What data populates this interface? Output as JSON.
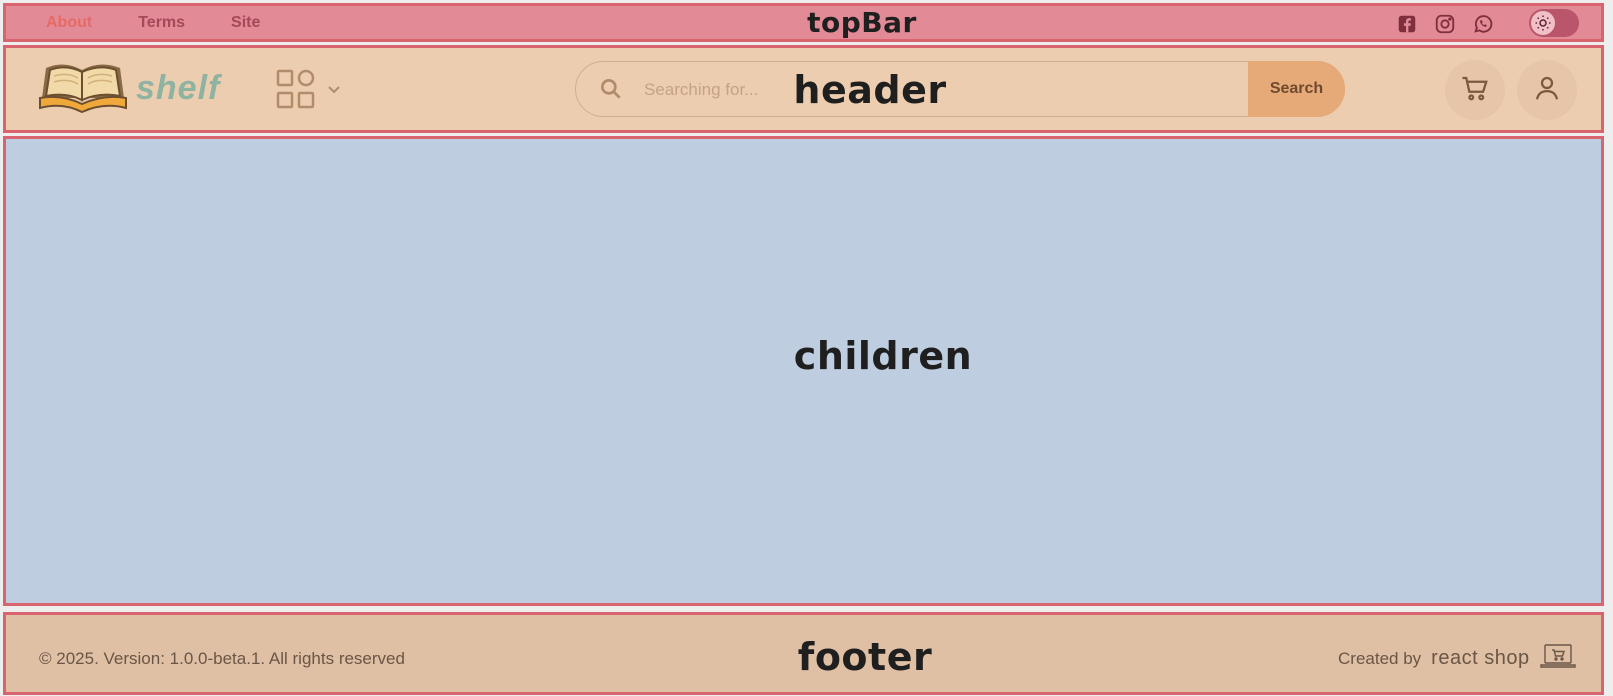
{
  "topbar": {
    "region_label": "topBar",
    "links": [
      {
        "label": "About",
        "active": true
      },
      {
        "label": "Terms",
        "active": false
      },
      {
        "label": "Site",
        "active": false
      }
    ],
    "social_icons": [
      "facebook-icon",
      "instagram-icon",
      "whatsapp-icon"
    ],
    "theme_toggle_icon": "sun-icon"
  },
  "header": {
    "region_label": "header",
    "logo_text": "shelf",
    "category_icon": "grid-icon",
    "search": {
      "placeholder": "Searching for...",
      "button_label": "Search"
    },
    "cart_icon": "cart-icon",
    "user_icon": "user-icon"
  },
  "children": {
    "region_label": "children"
  },
  "footer": {
    "region_label": "footer",
    "copyright": "© 2025. Version: 1.0.0-beta.1. All rights reserved",
    "created_by": "Created by",
    "brand": "react shop"
  },
  "colors": {
    "outline": "#d9646f",
    "topbar_bg": "#e28a96",
    "header_bg": "#eccdb0",
    "children_bg": "#bfcde0",
    "footer_bg": "#e0c0a4",
    "search_button": "#e6a978"
  }
}
